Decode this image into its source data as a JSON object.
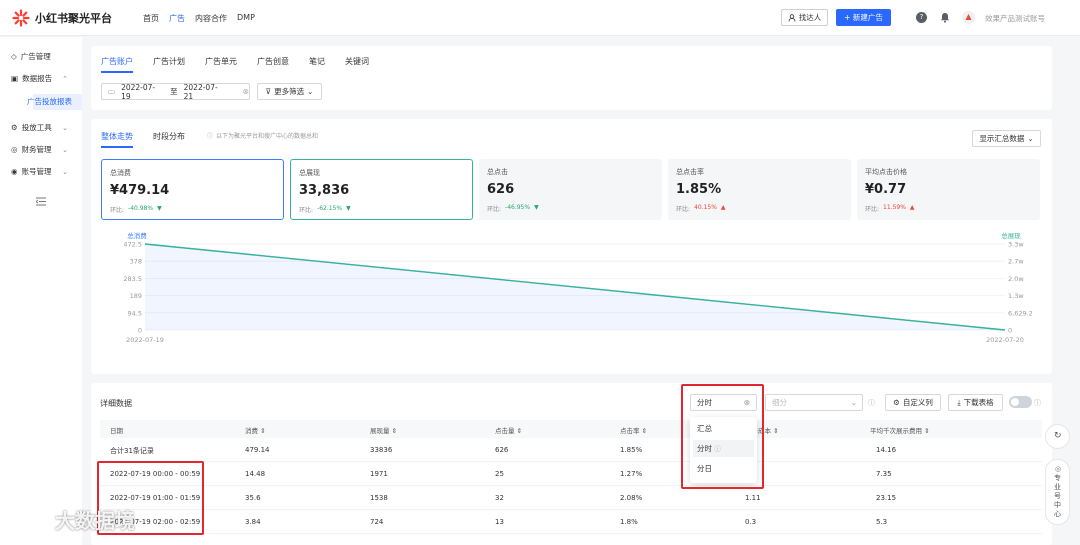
{
  "app": {
    "title": "小红书聚光平台",
    "nav": [
      "首页",
      "广告",
      "内容合作",
      "DMP"
    ],
    "nav_active": "广告",
    "find_btn": "找达人",
    "new_btn": "+ 新建广告",
    "account": "效果产品测试账号"
  },
  "sidebar": {
    "items": [
      {
        "label": "广告管理",
        "icon": "tag-icon"
      },
      {
        "label": "数据报告",
        "icon": "chart-icon"
      },
      {
        "label": "投放工具",
        "icon": "tool-icon"
      },
      {
        "label": "财务管理",
        "icon": "wallet-icon"
      },
      {
        "label": "账号管理",
        "icon": "user-icon"
      }
    ],
    "sub_active": "广告投放报表"
  },
  "tabs": [
    "广告账户",
    "广告计划",
    "广告单元",
    "广告创意",
    "笔记",
    "关键词"
  ],
  "date": {
    "start": "2022-07-19",
    "sep": "至",
    "end": "2022-07-21"
  },
  "filter_btn": "更多筛选",
  "view_tabs": [
    "整体走势",
    "时段分布"
  ],
  "view_note": "以下为聚光平台和搜广中心的数据总和",
  "summary_btn": "显示汇总数据",
  "metrics": [
    {
      "label": "总消费",
      "value": "¥479.14",
      "change_label": "环比:",
      "change": "-40.98%",
      "dir": "down"
    },
    {
      "label": "总展现",
      "value": "33,836",
      "change_label": "环比:",
      "change": "-62.15%",
      "dir": "down"
    },
    {
      "label": "总点击",
      "value": "626",
      "change_label": "环比:",
      "change": "-46.95%",
      "dir": "down"
    },
    {
      "label": "总点击率",
      "value": "1.85%",
      "change_label": "环比:",
      "change": "40.15%",
      "dir": "up"
    },
    {
      "label": "平均点击价格",
      "value": "¥0.77",
      "change_label": "环比:",
      "change": "11.59%",
      "dir": "up"
    }
  ],
  "chart_data": {
    "type": "area",
    "x": [
      "2022-07-19",
      "2022-07-20"
    ],
    "series": [
      {
        "name": "总消费",
        "values": [
          472.5,
          0
        ],
        "color": "#3d7bff"
      },
      {
        "name": "总展现",
        "values": [
          33000,
          0
        ],
        "color": "#37b39a"
      }
    ],
    "y_left_ticks": [
      "472.5",
      "378",
      "283.5",
      "189",
      "94.5",
      "0"
    ],
    "y_right_ticks": [
      "3.3w",
      "2.7w",
      "2.0w",
      "1.3w",
      "6,629.2",
      "0"
    ],
    "ylim_left": [
      0,
      472.5
    ],
    "ylim_right": [
      0,
      33000
    ],
    "left_label": "总消费",
    "right_label": "总展现"
  },
  "table": {
    "title": "详细数据",
    "granularity_value": "分时",
    "subdivide_placeholder": "细分",
    "custom_cols_btn": "自定义列",
    "download_btn": "下载表格",
    "headers": [
      "日期",
      "消费",
      "展现量",
      "点击量",
      "点击率",
      "点击成本",
      "平均千次展示费用"
    ],
    "rows": [
      [
        "合计31条记录",
        "479.14",
        "33836",
        "626",
        "1.85%",
        "",
        "14.16"
      ],
      [
        "2022-07-19 00:00 - 00:59",
        "14.48",
        "1971",
        "25",
        "1.27%",
        "",
        "7.35"
      ],
      [
        "2022-07-19 01:00 - 01:59",
        "35.6",
        "1538",
        "32",
        "2.08%",
        "1.11",
        "23.15"
      ],
      [
        "2022-07-19 02:00 - 02:59",
        "3.84",
        "724",
        "13",
        "1.8%",
        "0.3",
        "5.3"
      ]
    ]
  },
  "dropdown": {
    "options": [
      "汇总",
      "分时",
      "分日"
    ],
    "active": "分时"
  },
  "float": {
    "pro_label": "专业号中心"
  },
  "watermark": "大数据境"
}
